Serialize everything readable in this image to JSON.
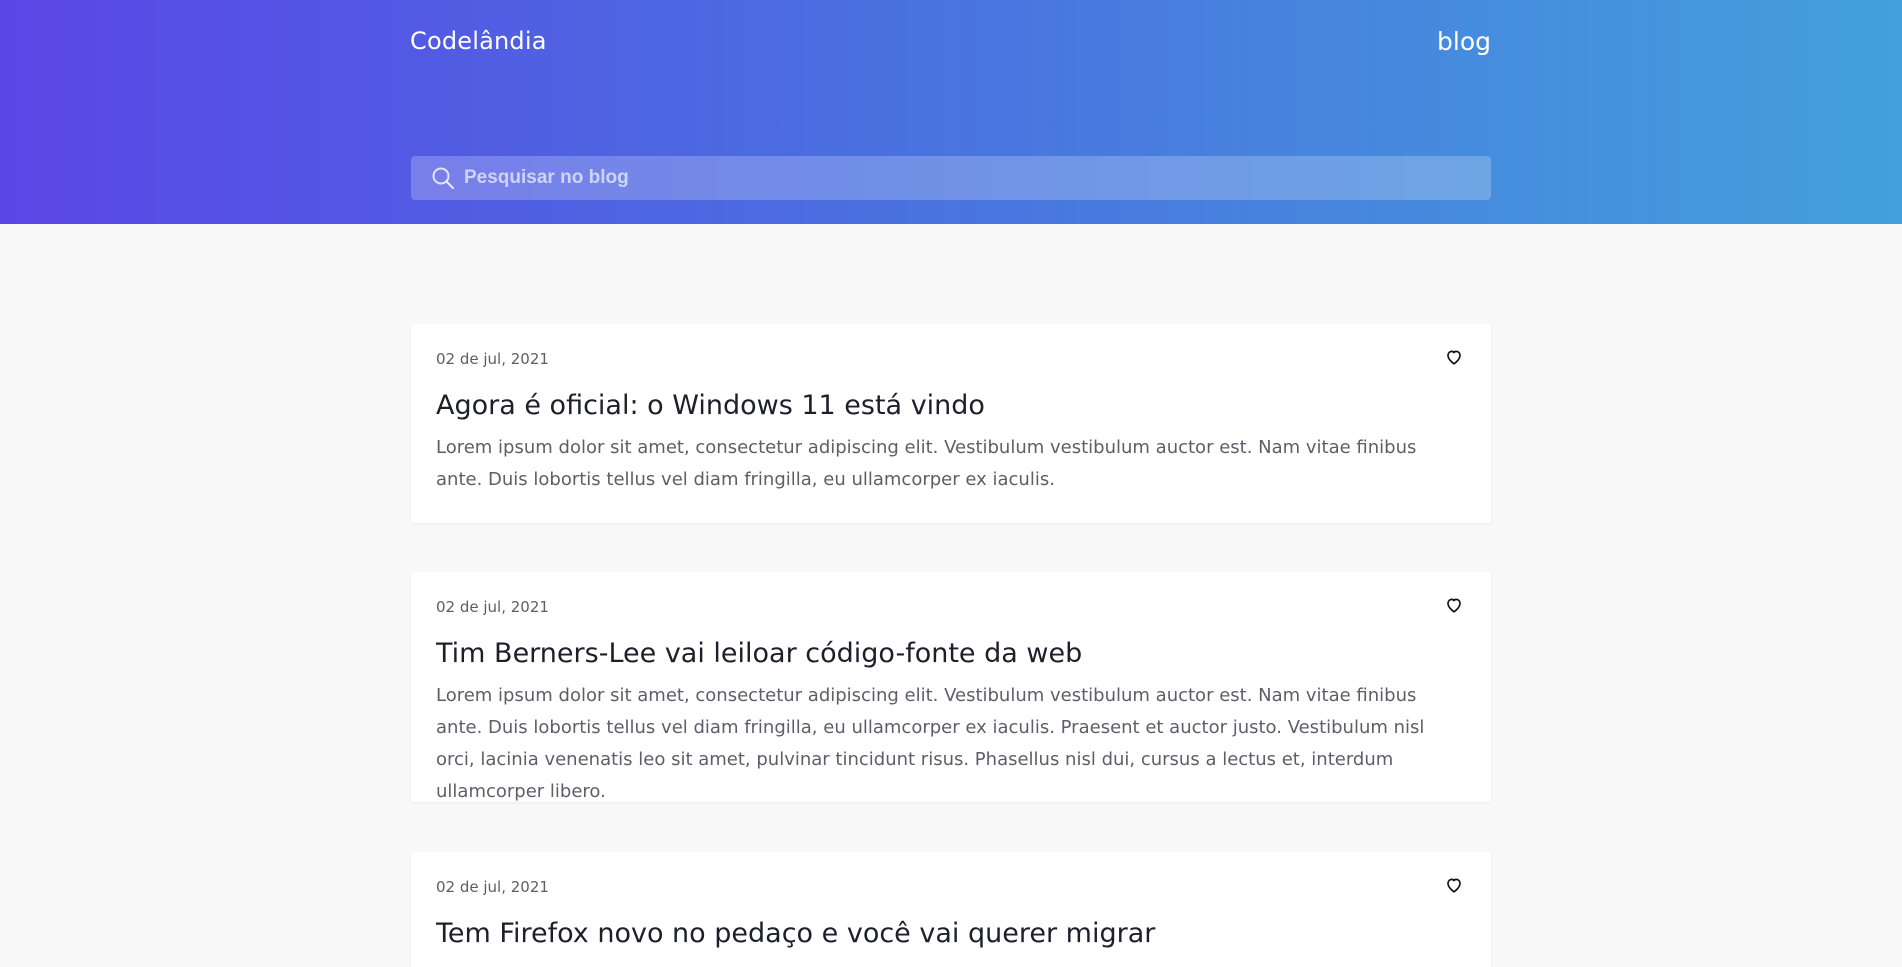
{
  "header": {
    "logo": "Codelândia",
    "nav_blog": "blog",
    "search": {
      "placeholder": "Pesquisar no blog",
      "value": ""
    }
  },
  "posts": [
    {
      "date": "02 de jul, 2021",
      "title": "Agora é oficial: o Windows 11 está vindo",
      "text": "Lorem ipsum dolor sit amet, consectetur adipiscing elit. Vestibulum vestibulum auctor est. Nam vitae finibus ante. Duis lobortis tellus vel diam fringilla, eu ullamcorper ex iaculis."
    },
    {
      "date": "02 de jul, 2021",
      "title": "Tim Berners-Lee vai leiloar código-fonte da web",
      "text": "Lorem ipsum dolor sit amet, consectetur adipiscing elit. Vestibulum vestibulum auctor est. Nam vitae finibus ante. Duis lobortis tellus vel diam fringilla, eu ullamcorper ex iaculis. Praesent et auctor justo. Vestibulum nisl orci, lacinia venenatis leo sit amet, pulvinar tincidunt risus. Phasellus nisl dui, cursus a lectus et, interdum ullamcorper libero."
    },
    {
      "date": "02 de jul, 2021",
      "title": "Tem Firefox novo no pedaço e você vai querer migrar",
      "text": ""
    }
  ],
  "icons": {
    "search": "search-icon",
    "like": "heart-icon"
  },
  "colors": {
    "gradient_start": "#5a46e7",
    "gradient_end": "#43a0dc",
    "background": "#f8f8f8"
  }
}
